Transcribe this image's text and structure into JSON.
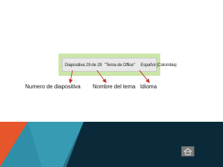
{
  "status_bar": {
    "slide_indicator": "Diapositiva 29 de 29",
    "theme_name": "\"Tema de Office\"",
    "language": "Español (Colombia)",
    "spellcheck_icon": "proofing-check-icon"
  },
  "labels": {
    "slide_number": "Numero de diapositiva",
    "theme_name": "Nombre del tema",
    "language": "Idioma"
  },
  "colors": {
    "highlight_green": "#cbe6a8",
    "arrow_red": "#c0392b",
    "band_dark": "#0a2a3a",
    "band_teal": "#2f8fa8",
    "band_orange": "#e5562a"
  },
  "home_button": {
    "icon": "home-icon"
  }
}
